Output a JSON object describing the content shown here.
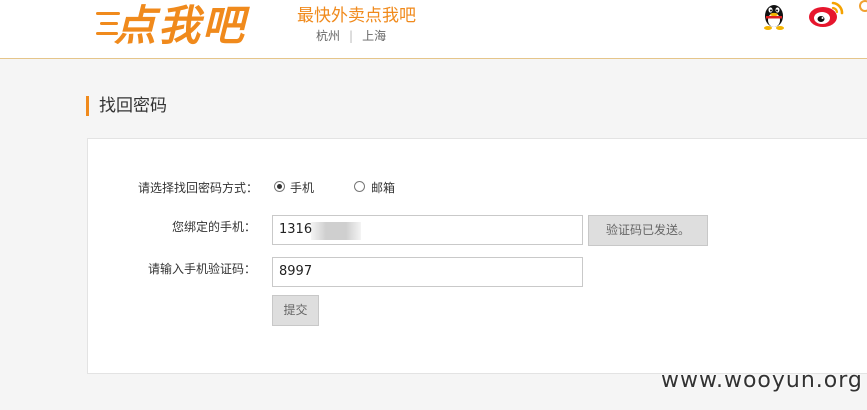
{
  "header": {
    "logo_text": "点我吧",
    "slogan": "最快外卖点我吧",
    "cities": [
      "杭州",
      "上海"
    ],
    "brand_color": "#f08a1c",
    "icons": [
      "qq-icon",
      "weibo-icon"
    ]
  },
  "page": {
    "section_title": "找回密码"
  },
  "form": {
    "method_label": "请选择找回密码方式：",
    "method_options": [
      "手机",
      "邮箱"
    ],
    "method_selected": "手机",
    "phone_label": "您绑定的手机：",
    "phone_value": "1316",
    "code_sent_button": "验证码已发送。",
    "code_label": "请输入手机验证码：",
    "code_value": "8997",
    "submit_button": "提交"
  },
  "watermark": "www.wooyun.org"
}
